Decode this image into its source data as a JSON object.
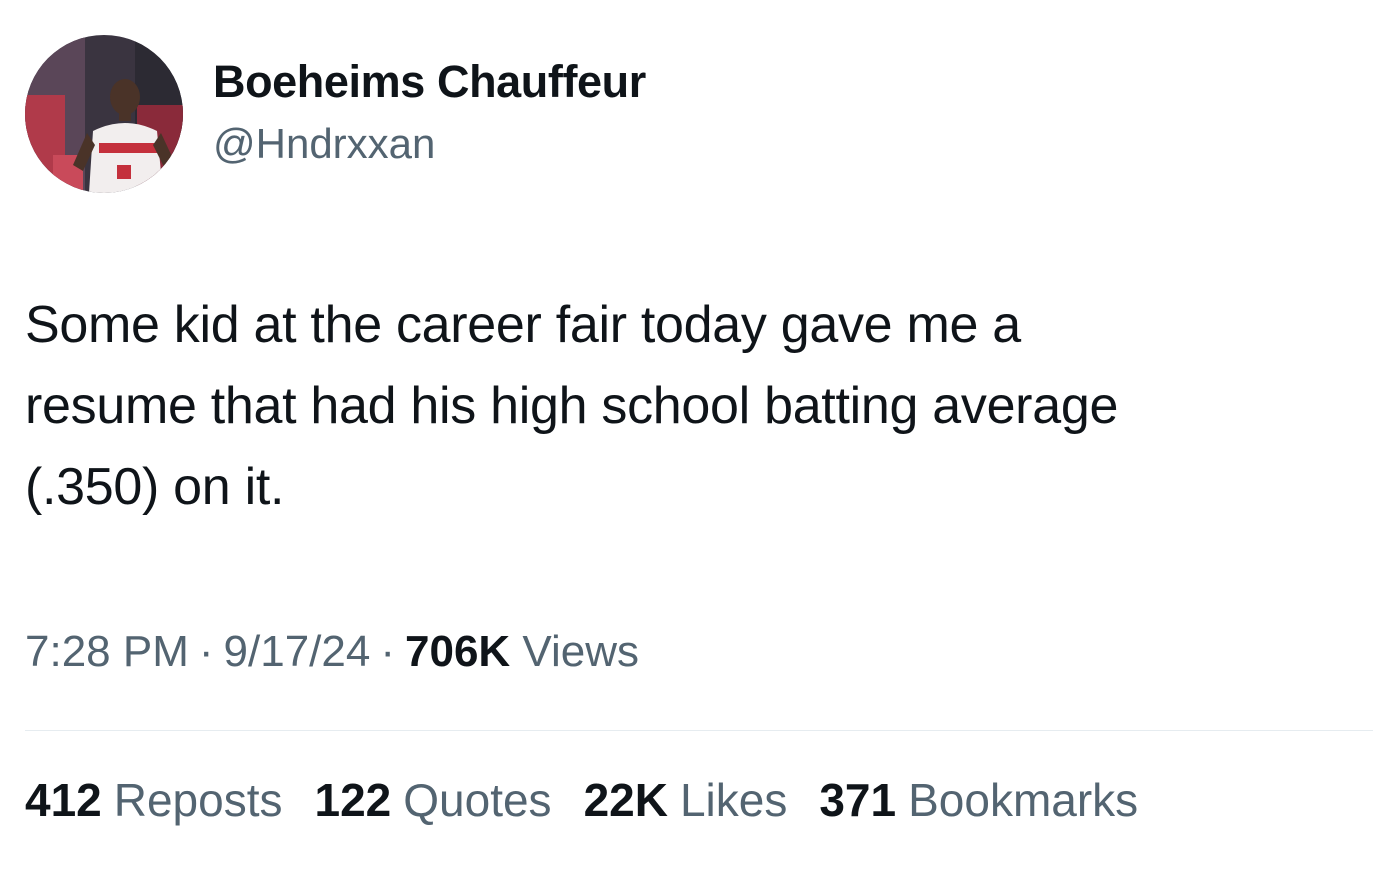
{
  "author": {
    "name": "Boeheims Chauffeur",
    "handle": "@Hndrxxan"
  },
  "tweet": {
    "lines": [
      "Some kid at the career fair today gave me a",
      "resume that had his high school batting average",
      "(.350) on it."
    ]
  },
  "meta": {
    "time": "7:28 PM",
    "date": "9/17/24",
    "separator": "·",
    "views_count": "706K",
    "views_label": "Views"
  },
  "stats": [
    {
      "count": "412",
      "label": "Reposts"
    },
    {
      "count": "122",
      "label": "Quotes"
    },
    {
      "count": "22K",
      "label": "Likes"
    },
    {
      "count": "371",
      "label": "Bookmarks"
    }
  ],
  "colors": {
    "text_primary": "#0f1419",
    "text_secondary": "#536471",
    "divider": "#e6ecf0",
    "background": "#ffffff"
  }
}
